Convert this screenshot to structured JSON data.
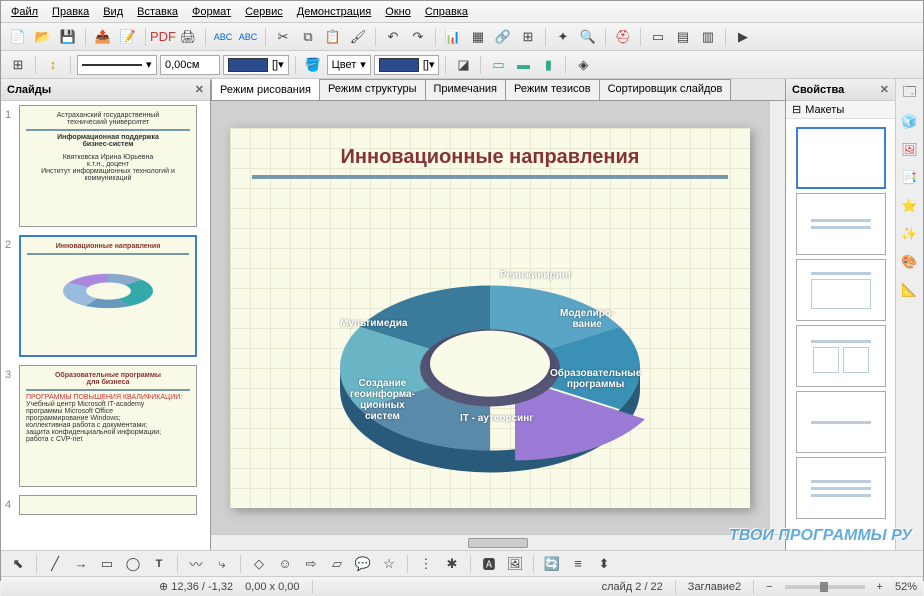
{
  "menu": [
    "Файл",
    "Правка",
    "Вид",
    "Вставка",
    "Формат",
    "Сервис",
    "Демонстрация",
    "Окно",
    "Справка"
  ],
  "toolbar2": {
    "size_value": "0,00см",
    "color_label": "Цвет"
  },
  "slides_panel": {
    "title": "Слайды"
  },
  "thumbs": [
    {
      "num": "1",
      "title_lines": [
        "Астраханский государственный",
        "технический университет",
        "",
        "Информационная поддержка",
        "бизнес-систем",
        "",
        "Квятковска Ирина Юрьевна",
        "к.т.н., доцент",
        "Институт информационных технологий и коммуникаций"
      ]
    },
    {
      "num": "2",
      "title_lines": [
        "Инновационные направления"
      ]
    },
    {
      "num": "3",
      "title_lines": [
        "Образовательные программы",
        "для бизнеса",
        "ПРОГРАММЫ ПОВЫШЕНИЯ КВАЛИФИКАЦИИ:",
        "Учебный центр Microsoft IT-academy",
        "программы Microsoft Office",
        "программирование Windows;",
        "коллективная работа с документами;",
        "защита конфиденциальной информации;",
        "работа с CVP-net"
      ]
    },
    {
      "num": "4",
      "title_lines": [
        ""
      ]
    }
  ],
  "view_tabs": [
    "Режим рисования",
    "Режим структуры",
    "Примечания",
    "Режим тезисов",
    "Сортировщик слайдов"
  ],
  "slide": {
    "title": "Инновационные направления",
    "segments": [
      "Реинжиниринг",
      "Моделиро-\nвание",
      "Образовательные\nпрограммы",
      "IT - аутсорсинг",
      "Создание\nгеоинформа-\nционных\nсистем",
      "Мультимедиа"
    ]
  },
  "props_panel": {
    "title": "Свойства",
    "section": "Макеты"
  },
  "statusbar": {
    "coords": "12,36 / -1,32",
    "size": "0,00 x 0,00",
    "slide_info": "слайд 2 / 22",
    "master": "Заглавие2",
    "zoom": "52%"
  },
  "watermark": "ТВОИ ПРОГРАММЫ РУ",
  "chart_data": {
    "type": "pie",
    "title": "Инновационные направления",
    "categories": [
      "Реинжиниринг",
      "Моделирование",
      "Образовательные программы",
      "IT - аутсорсинг",
      "Создание геоинформационных систем",
      "Мультимедиа"
    ],
    "values": [
      1,
      1,
      1,
      1,
      1,
      1
    ]
  }
}
